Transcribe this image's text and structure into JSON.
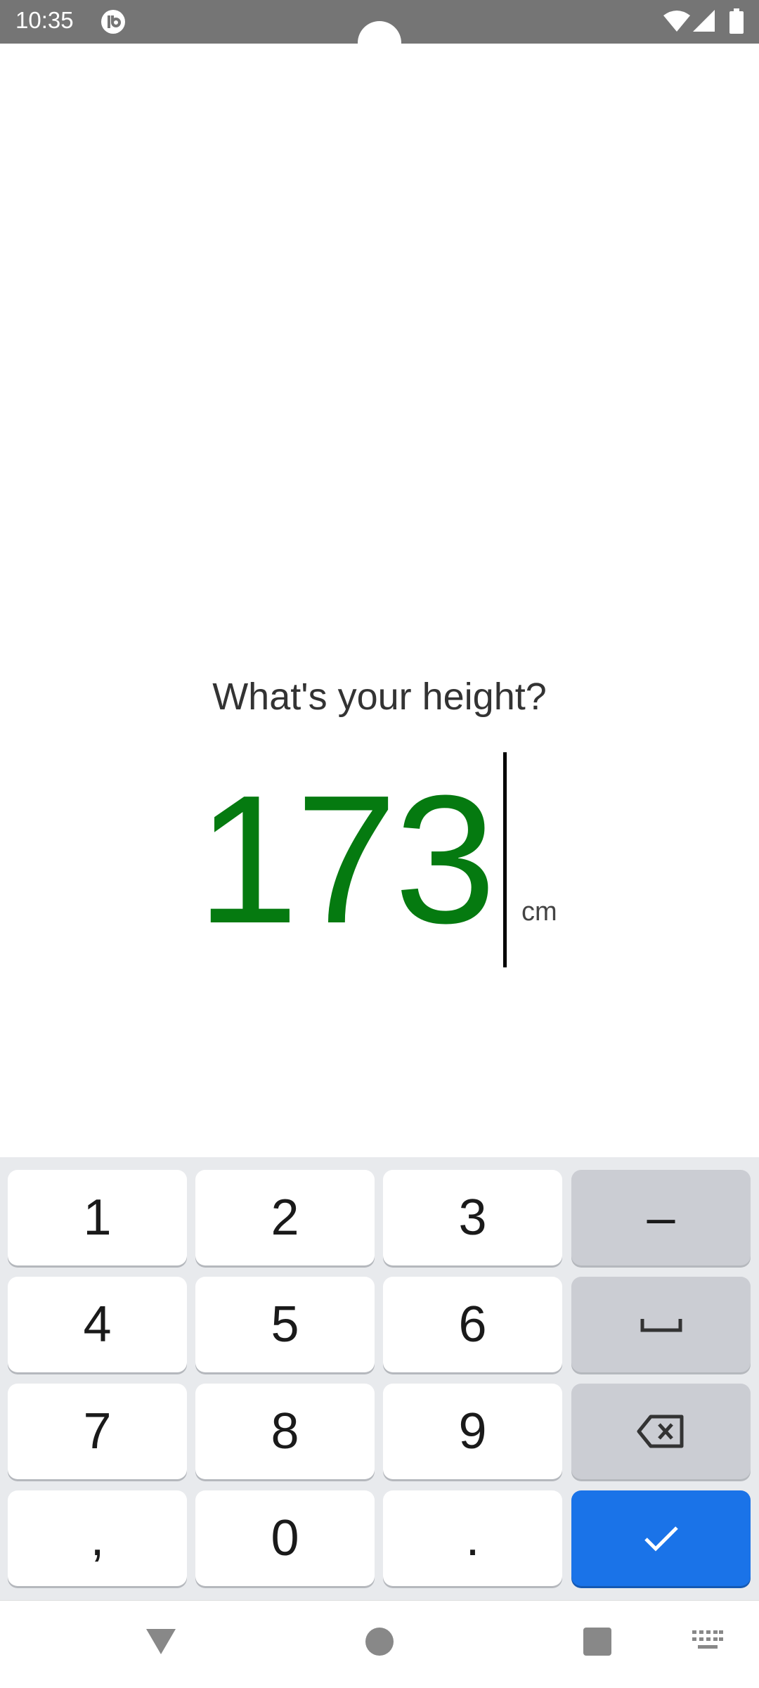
{
  "status_bar": {
    "time": "10:35",
    "icons": [
      "app-notification-icon",
      "wifi-icon",
      "signal-icon",
      "battery-icon"
    ]
  },
  "prompt": {
    "question": "What's your height?",
    "value": "173",
    "unit": "cm",
    "value_color": "#057a10"
  },
  "keyboard": {
    "keys": {
      "k1": "1",
      "k2": "2",
      "k3": "3",
      "minus": "–",
      "k4": "4",
      "k5": "5",
      "k6": "6",
      "k7": "7",
      "k8": "8",
      "k9": "9",
      "comma": ",",
      "k0": "0",
      "period": "."
    },
    "function_icons": [
      "space-icon",
      "backspace-icon",
      "check-icon"
    ],
    "enter_color": "#1a73e8"
  },
  "nav_bar": {
    "icons": [
      "back-icon",
      "home-icon",
      "recents-icon",
      "keyboard-switch-icon"
    ]
  }
}
